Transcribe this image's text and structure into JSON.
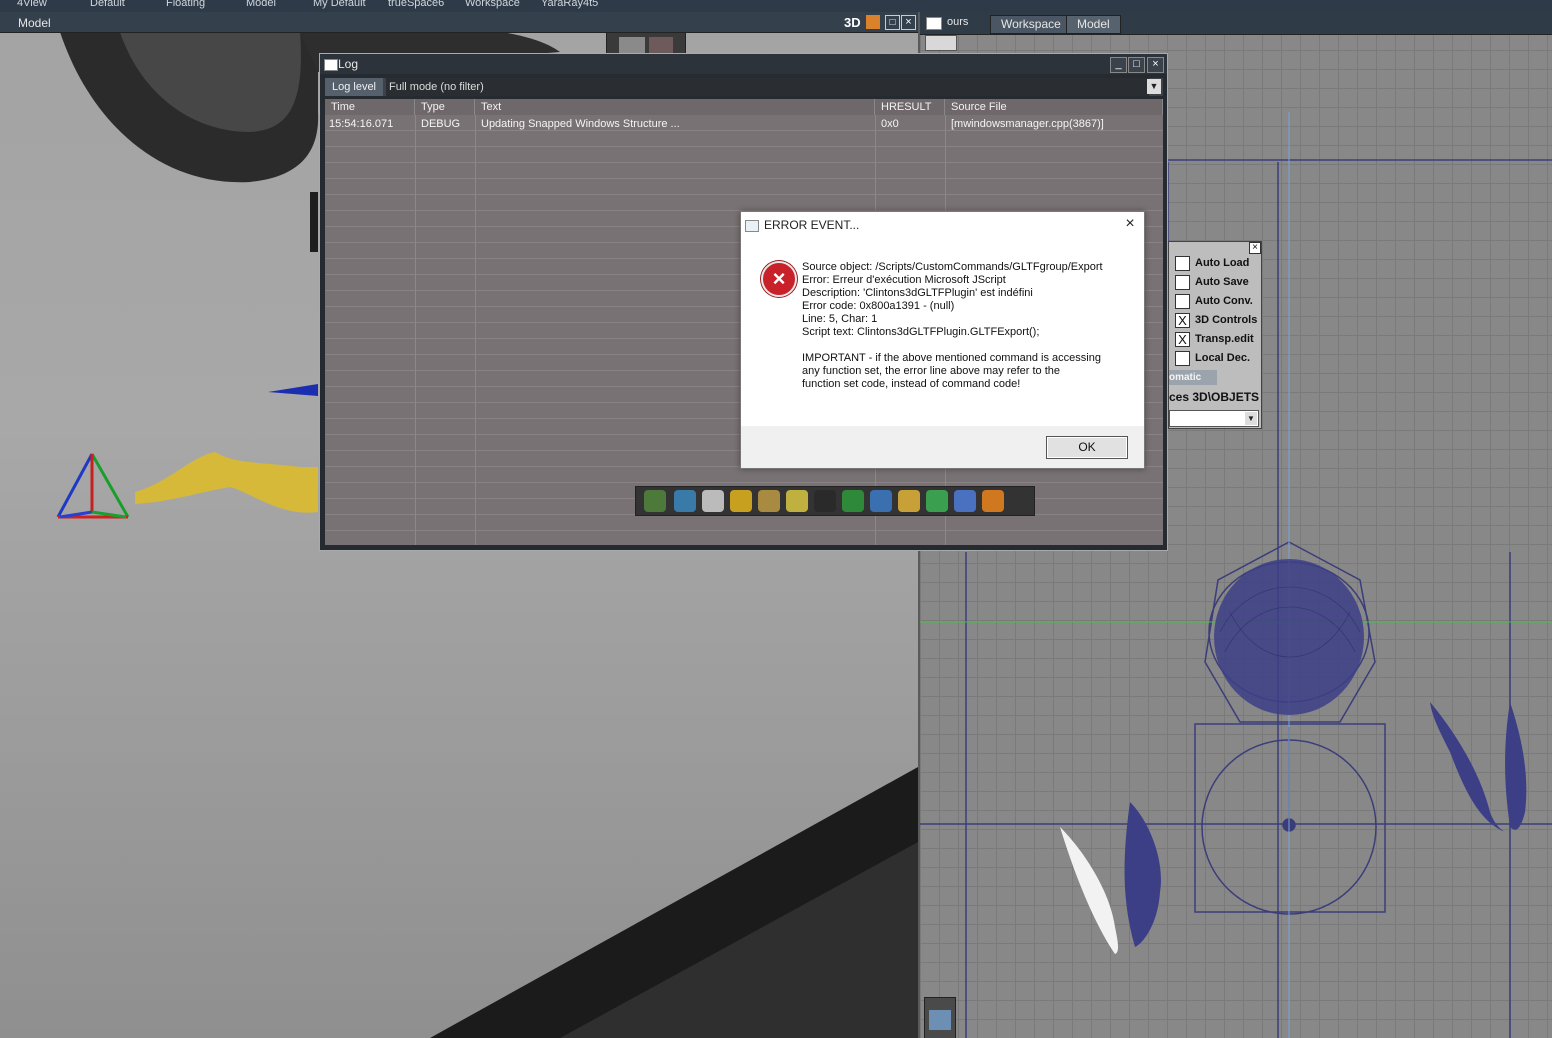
{
  "workspace_tabs": [
    "4View",
    "Default",
    "Floating",
    "Model",
    "My Default",
    "trueSpace6",
    "Workspace",
    "YaraRay4t5"
  ],
  "left_view": {
    "title": "Model",
    "mode": "3D"
  },
  "right_view": {
    "tabs": [
      "ours",
      "Workspace",
      "Model"
    ]
  },
  "options_panel": {
    "items": [
      {
        "label": "Auto Load",
        "checked": false,
        "mark": ""
      },
      {
        "label": "Auto Save",
        "checked": false,
        "mark": ""
      },
      {
        "label": "Auto Conv.",
        "checked": false,
        "mark": ""
      },
      {
        "label": "3D Controls",
        "checked": true,
        "mark": "X"
      },
      {
        "label": "Transp.edit",
        "checked": true,
        "mark": "X"
      },
      {
        "label": "Local Dec.",
        "checked": false,
        "mark": ""
      }
    ],
    "partial_button": "omatic",
    "path_text": "ces 3D\\OBJETS"
  },
  "log_window": {
    "title": "Log",
    "log_level_label": "Log level",
    "log_level_value": "Full mode  (no filter)",
    "columns": [
      "Time",
      "Type",
      "Text",
      "HRESULT",
      "Source File"
    ],
    "rows": [
      {
        "time": "15:54:16.071",
        "type": "DEBUG",
        "text": "Updating Snapped Windows Structure ...",
        "hresult": "0x0",
        "source": "[mwindowsmanager.cpp(3867)]"
      }
    ]
  },
  "error_dialog": {
    "title": "ERROR EVENT...",
    "lines": [
      "Source object: /Scripts/CustomCommands/GLTFgroup/Export",
      "Error: Erreur d'exécution Microsoft JScript",
      "Description: 'Clintons3dGLTFPlugin' est indéfini",
      "Error code: 0x800a1391 - (null)",
      "Line: 5, Char: 1",
      "Script text:  Clintons3dGLTFPlugin.GLTFExport();"
    ],
    "important_lines": [
      "IMPORTANT - if the above mentioned command is accessing",
      "any function set, the error line above may refer to the",
      "function set code, instead of command code!"
    ],
    "ok_label": "OK"
  },
  "icon_names": [
    "close-icon",
    "maximize-icon",
    "minimize-icon",
    "error-icon",
    "dropdown-arrow-icon"
  ]
}
